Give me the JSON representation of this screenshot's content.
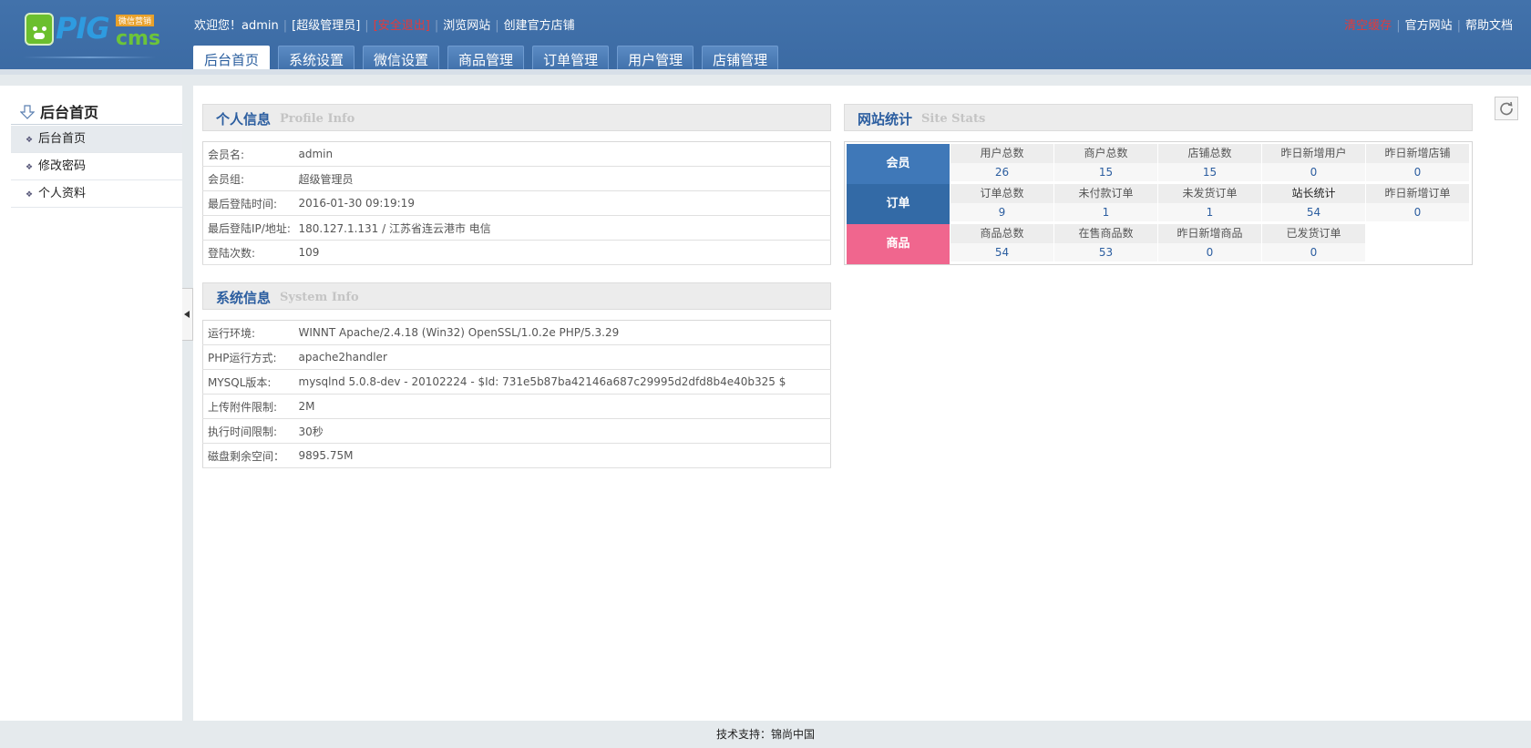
{
  "logo": {
    "main": "PIG",
    "suffix": "cms",
    "tag": "微信营销"
  },
  "userbar": {
    "welcome": "欢迎您！admin",
    "role": "[超级管理员]",
    "logout": "[安全退出]",
    "browse": "浏览网站",
    "create_store": "创建官方店铺"
  },
  "toplinks": {
    "clear_cache": "清空缓存",
    "official_site": "官方网站",
    "help": "帮助文档"
  },
  "nav": {
    "tabs": [
      {
        "label": "后台首页",
        "active": true
      },
      {
        "label": "系统设置"
      },
      {
        "label": "微信设置"
      },
      {
        "label": "商品管理"
      },
      {
        "label": "订单管理"
      },
      {
        "label": "用户管理"
      },
      {
        "label": "店铺管理"
      }
    ]
  },
  "sidebar": {
    "title": "后台首页",
    "items": [
      {
        "label": "后台首页",
        "active": true
      },
      {
        "label": "修改密码"
      },
      {
        "label": "个人资料"
      }
    ]
  },
  "profile": {
    "title_cn": "个人信息",
    "title_en": "Profile  Info",
    "rows": [
      {
        "k": "会员名:",
        "v": "admin"
      },
      {
        "k": "会员组:",
        "v": "超级管理员"
      },
      {
        "k": "最后登陆时间:",
        "v": "2016-01-30 09:19:19"
      },
      {
        "k": "最后登陆IP/地址:",
        "v": "180.127.1.131 / 江苏省连云港市 电信"
      },
      {
        "k": "登陆次数:",
        "v": "109"
      }
    ]
  },
  "system": {
    "title_cn": "系统信息",
    "title_en": "System  Info",
    "rows": [
      {
        "k": "运行环境:",
        "v": "WINNT Apache/2.4.18 (Win32) OpenSSL/1.0.2e PHP/5.3.29"
      },
      {
        "k": "PHP运行方式:",
        "v": "apache2handler"
      },
      {
        "k": "MYSQL版本:",
        "v": "mysqlnd 5.0.8-dev - 20102224 - $Id: 731e5b87ba42146a687c29995d2dfd8b4e40b325 $"
      },
      {
        "k": "上传附件限制:",
        "v": "2M"
      },
      {
        "k": "执行时间限制:",
        "v": "30秒"
      },
      {
        "k": "磁盘剩余空间：",
        "v": "9895.75M"
      }
    ]
  },
  "stats": {
    "title_cn": "网站统计",
    "title_en": "Site  Stats",
    "groups": [
      {
        "label": "会员",
        "color": "#3f78b8",
        "cells": [
          {
            "t": "用户总数",
            "v": "26"
          },
          {
            "t": "商户总数",
            "v": "15"
          },
          {
            "t": "店铺总数",
            "v": "15"
          },
          {
            "t": "昨日新增用户",
            "v": "0"
          },
          {
            "t": "昨日新增店铺",
            "v": "0"
          }
        ]
      },
      {
        "label": "订单",
        "color": "#336aa6",
        "cells": [
          {
            "t": "订单总数",
            "v": "9"
          },
          {
            "t": "未付款订单",
            "v": "1"
          },
          {
            "t": "未发货订单",
            "v": "1"
          },
          {
            "t": "站长统计",
            "v": "54"
          },
          {
            "t": "昨日新增订单",
            "v": "0"
          }
        ]
      },
      {
        "label": "商品",
        "color": "#f0668e",
        "cells": [
          {
            "t": "商品总数",
            "v": "54"
          },
          {
            "t": "在售商品数",
            "v": "53"
          },
          {
            "t": "昨日新增商品",
            "v": "0"
          },
          {
            "t": "已发货订单",
            "v": "0"
          }
        ]
      }
    ]
  },
  "footer": {
    "text": "技术支持：锦尚中国"
  }
}
